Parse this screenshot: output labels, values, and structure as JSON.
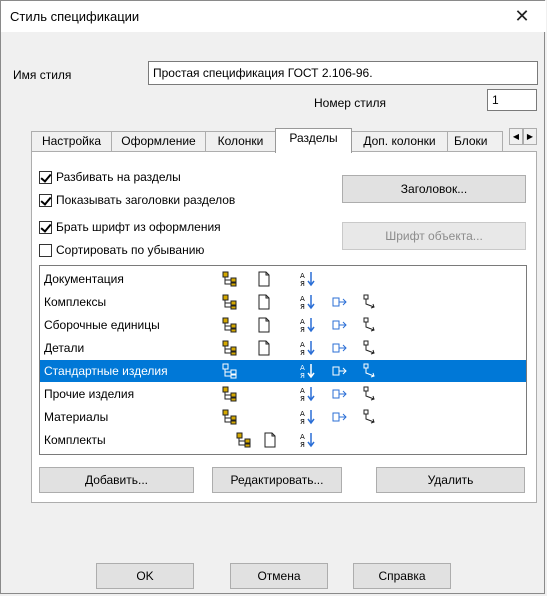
{
  "window": {
    "title": "Стиль спецификации",
    "close_glyph": "✕"
  },
  "style_name": {
    "label": "Имя стиля",
    "value": "Простая спецификация ГОСТ 2.106-96."
  },
  "style_number": {
    "label": "Номер стиля",
    "value": "1"
  },
  "tabs": [
    {
      "label": "Настройка",
      "active": false
    },
    {
      "label": "Оформление",
      "active": false
    },
    {
      "label": "Колонки",
      "active": false
    },
    {
      "label": "Разделы",
      "active": true
    },
    {
      "label": "Доп. колонки",
      "active": false
    },
    {
      "label": "Блоки",
      "active": false
    }
  ],
  "tab_scroll": {
    "left": "◀",
    "right": "▶"
  },
  "options": [
    {
      "label": "Разбивать на разделы",
      "checked": true
    },
    {
      "label": "Показывать заголовки разделов",
      "checked": true
    },
    {
      "label": "Брать шрифт из оформления",
      "checked": true
    },
    {
      "label": "Сортировать по убыванию",
      "checked": false
    }
  ],
  "buttons": {
    "header": "Заголовок...",
    "object_font": "Шрифт объекта...",
    "add": "Добавить...",
    "edit": "Редактировать...",
    "delete": "Удалить",
    "ok": "OK",
    "cancel": "Отмена",
    "help": "Справка"
  },
  "sections": [
    {
      "name": "Документация",
      "icons": [
        "tree-icon",
        "page-icon",
        "sort-icon"
      ],
      "selected": false
    },
    {
      "name": "Комплексы",
      "icons": [
        "tree-icon",
        "page-icon",
        "sort-icon",
        "link-icon",
        "arrow-icon"
      ],
      "selected": false
    },
    {
      "name": "Сборочные единицы",
      "icons": [
        "tree-icon",
        "page-icon",
        "sort-icon",
        "link-icon",
        "arrow-icon"
      ],
      "selected": false
    },
    {
      "name": "Детали",
      "icons": [
        "tree-icon",
        "page-icon",
        "sort-icon",
        "link-icon",
        "arrow-icon"
      ],
      "selected": false
    },
    {
      "name": "Стандартные изделия",
      "icons": [
        "tree-icon",
        "sort-icon",
        "link-icon",
        "arrow-icon"
      ],
      "selected": true
    },
    {
      "name": "Прочие изделия",
      "icons": [
        "tree-icon",
        "sort-icon",
        "link-icon",
        "arrow-icon"
      ],
      "selected": false
    },
    {
      "name": "Материалы",
      "icons": [
        "tree-icon",
        "sort-icon",
        "link-icon",
        "arrow-icon"
      ],
      "selected": false
    },
    {
      "name": "Комплекты",
      "icons": [
        "tree-icon",
        "page-icon",
        "sort-icon"
      ],
      "selected": false
    }
  ],
  "colors": {
    "selection": "#0078d7",
    "tree": "#d4a800",
    "link": "#2b6fd6"
  }
}
